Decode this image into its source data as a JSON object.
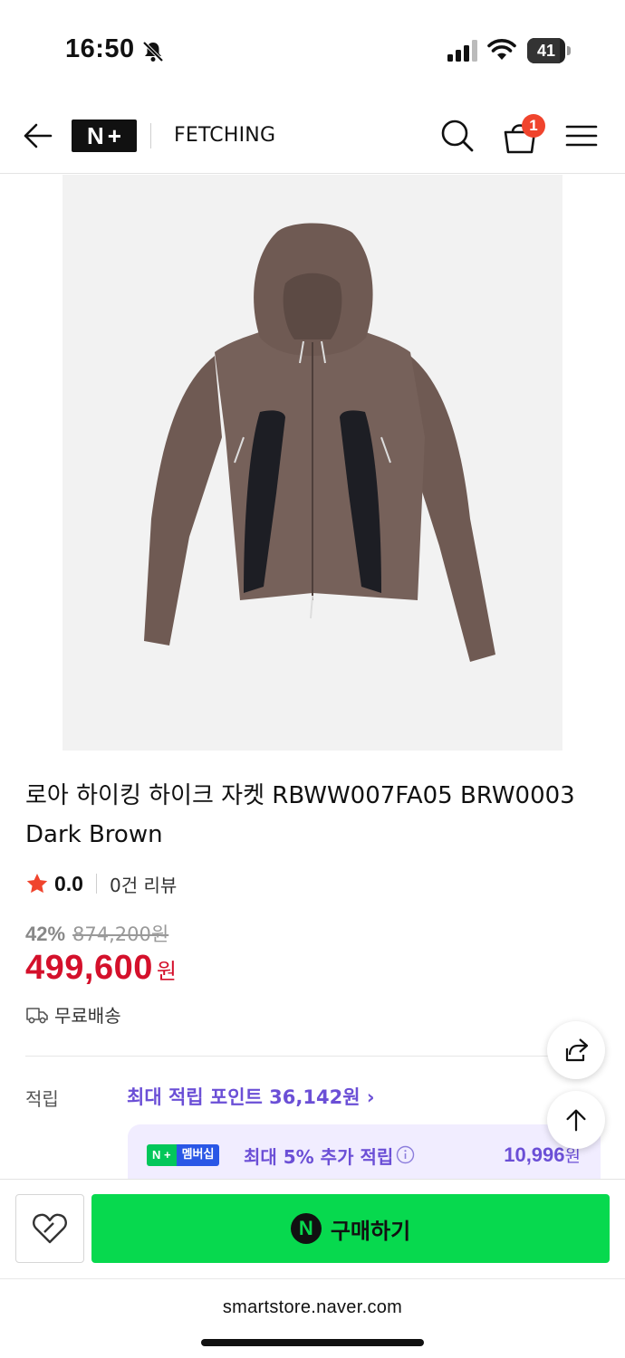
{
  "status_bar": {
    "time": "16:50",
    "battery": "41"
  },
  "nav": {
    "logo_n": "N",
    "logo_plus": "+",
    "store_name": "FETCHING",
    "cart_count": "1"
  },
  "product": {
    "title": "로아 하이킹 하이크 자켓 RBWW007FA05 BRW0003 Dark Brown",
    "rating": "0.0",
    "reviews": "0건 리뷰",
    "discount_percent": "42%",
    "original_price": "874,200원",
    "price": "499,600",
    "price_unit": "원",
    "shipping": "무료배송"
  },
  "points": {
    "label": "적립",
    "max_points": "최대 적립 포인트 36,142원 ›",
    "member_chip_n": "N +",
    "member_chip_label": "멤버십",
    "member_text": "최대 5% 추가 적립",
    "member_amount": "10,996",
    "member_unit": "원"
  },
  "actions": {
    "buy_label": "구매하기",
    "buy_logo": "N"
  },
  "browser": {
    "url": "smartstore.naver.com"
  },
  "colors": {
    "price_red": "#d4102b",
    "buy_green": "#07d94e",
    "points_purple": "#6b4fd6",
    "badge_red": "#f0442d"
  }
}
